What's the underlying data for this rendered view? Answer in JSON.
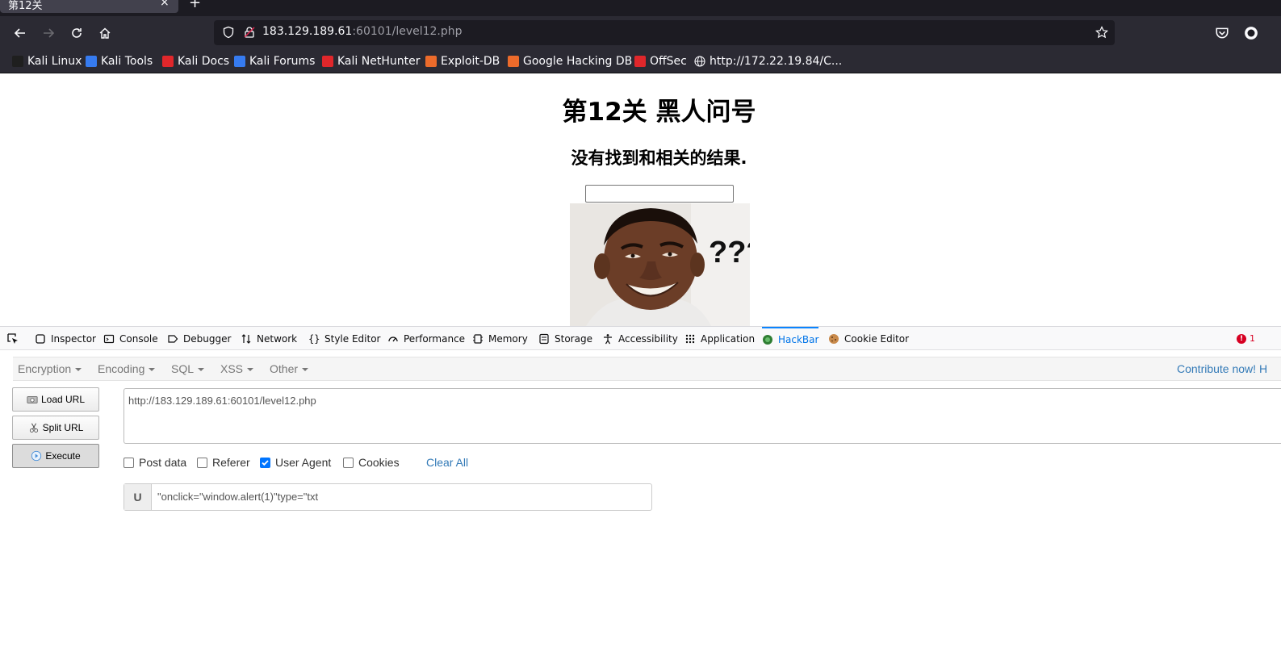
{
  "browser": {
    "tab": {
      "title": "第12关",
      "close": "×",
      "new_tab": "+"
    },
    "url": {
      "host": "183.129.189.61",
      "rest": ":60101/level12.php"
    },
    "bookmarks": [
      {
        "label": "Kali Linux",
        "icon": "kali-dragon-icon",
        "color": "#1f1f1f"
      },
      {
        "label": "Kali Tools",
        "icon": "kali-tools-icon",
        "color": "#367bf0"
      },
      {
        "label": "Kali Docs",
        "icon": "kali-docs-icon",
        "color": "#e0272b"
      },
      {
        "label": "Kali Forums",
        "icon": "kali-forums-icon",
        "color": "#367bf0"
      },
      {
        "label": "Kali NetHunter",
        "icon": "nethunter-icon",
        "color": "#e0272b"
      },
      {
        "label": "Exploit-DB",
        "icon": "exploit-db-icon",
        "color": "#ec6b2b"
      },
      {
        "label": "Google Hacking DB",
        "icon": "ghdb-icon",
        "color": "#ec6b2b"
      },
      {
        "label": "OffSec",
        "icon": "offsec-icon",
        "color": "#e0272b"
      },
      {
        "label": "http://172.22.19.84/C...",
        "icon": "globe-icon",
        "color": "#fbfbfe"
      }
    ]
  },
  "page": {
    "title": "第12关 黑人问号",
    "message": "没有找到和相关的结果.",
    "image_caption": "???"
  },
  "devtools": {
    "tabs": [
      {
        "label": "Inspector",
        "icon": "inspector-icon"
      },
      {
        "label": "Console",
        "icon": "console-icon"
      },
      {
        "label": "Debugger",
        "icon": "debugger-icon"
      },
      {
        "label": "Network",
        "icon": "network-icon"
      },
      {
        "label": "Style Editor",
        "icon": "style-editor-icon"
      },
      {
        "label": "Performance",
        "icon": "performance-icon"
      },
      {
        "label": "Memory",
        "icon": "memory-icon"
      },
      {
        "label": "Storage",
        "icon": "storage-icon"
      },
      {
        "label": "Accessibility",
        "icon": "accessibility-icon"
      },
      {
        "label": "Application",
        "icon": "application-icon"
      },
      {
        "label": "HackBar",
        "icon": "hackbar-icon",
        "active": true
      },
      {
        "label": "Cookie Editor",
        "icon": "cookie-icon"
      }
    ],
    "error_count": "1",
    "hackbar": {
      "menu": [
        "Encryption",
        "Encoding",
        "SQL",
        "XSS",
        "Other"
      ],
      "contribute": "Contribute now! H",
      "buttons": {
        "load": "Load URL",
        "split": "Split URL",
        "execute": "Execute"
      },
      "url_value": "http://183.129.189.61:60101/level12.php",
      "checks": [
        {
          "label": "Post data",
          "checked": false
        },
        {
          "label": "Referer",
          "checked": false
        },
        {
          "label": "User Agent",
          "checked": true
        },
        {
          "label": "Cookies",
          "checked": false
        }
      ],
      "clear_all": "Clear All",
      "user_agent": {
        "label": "U",
        "value": "\"onclick=\"window.alert(1)\"type=\"txt"
      }
    }
  },
  "colors": {
    "chrome_dark": "#1c1b22",
    "chrome": "#2b2a33",
    "accent": "#0a84ff",
    "link": "#337ab7"
  }
}
